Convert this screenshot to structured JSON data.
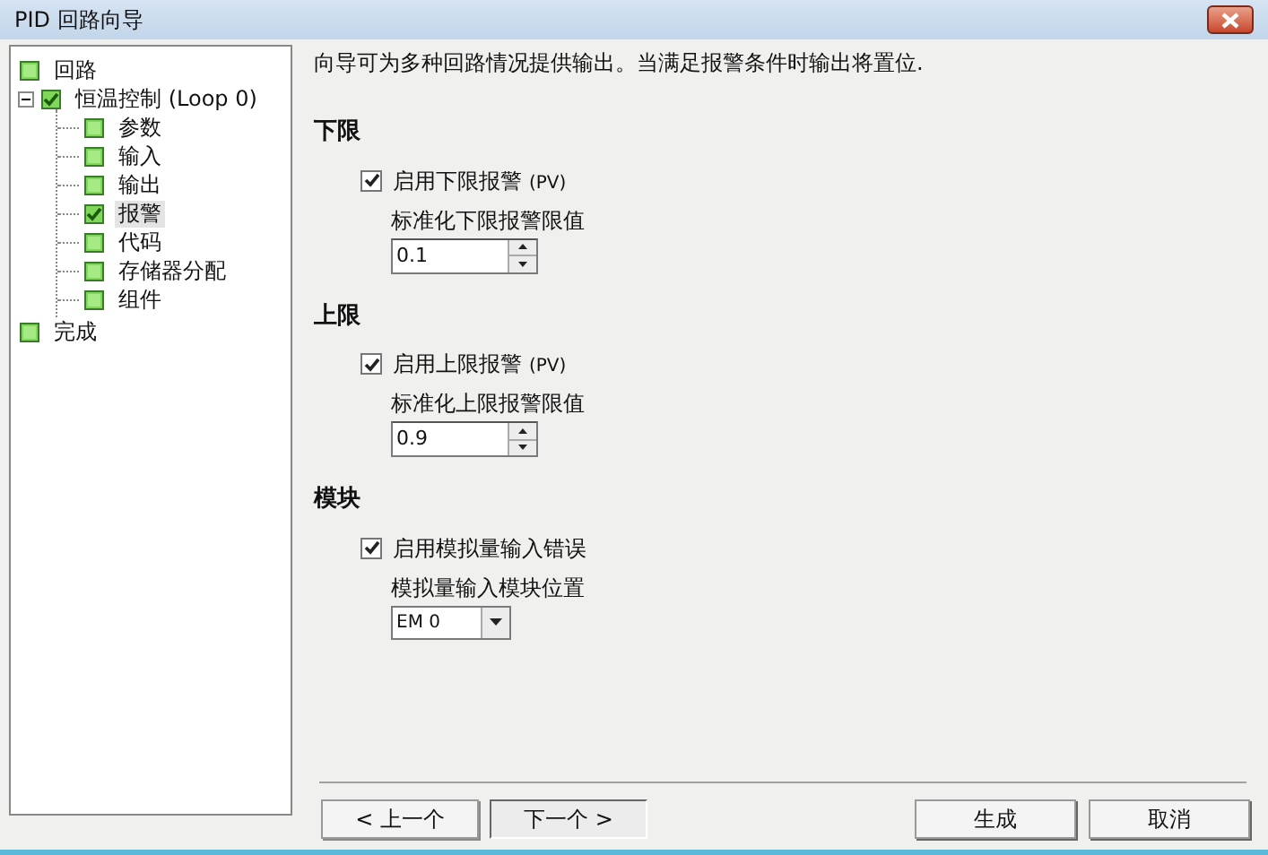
{
  "window": {
    "title": "PID 回路向导"
  },
  "tree": [
    {
      "label": "回路",
      "checked": false,
      "selected": false
    },
    {
      "label": "恒温控制 (Loop 0)",
      "checked": true,
      "selected": false,
      "expanded": true,
      "children": [
        {
          "label": "参数",
          "checked": false,
          "selected": false
        },
        {
          "label": "输入",
          "checked": false,
          "selected": false
        },
        {
          "label": "输出",
          "checked": false,
          "selected": false
        },
        {
          "label": "报警",
          "checked": true,
          "selected": true
        },
        {
          "label": "代码",
          "checked": false,
          "selected": false
        },
        {
          "label": "存储器分配",
          "checked": false,
          "selected": false
        },
        {
          "label": "组件",
          "checked": false,
          "selected": false
        }
      ]
    },
    {
      "label": "完成",
      "checked": false,
      "selected": false
    }
  ],
  "intro": "向导可为多种回路情况提供输出。当满足报警条件时输出将置位.",
  "sections": [
    {
      "heading": "下限",
      "checkbox": {
        "label": "启用下限报警",
        "suffix": "(PV)",
        "checked": true
      },
      "field_label": "标准化下限报警限值",
      "field": {
        "kind": "spinner",
        "value": "0.1"
      }
    },
    {
      "heading": "上限",
      "checkbox": {
        "label": "启用上限报警",
        "suffix": "(PV)",
        "checked": true
      },
      "field_label": "标准化上限报警限值",
      "field": {
        "kind": "spinner",
        "value": "0.9"
      }
    },
    {
      "heading": "模块",
      "checkbox": {
        "label": "启用模拟量输入错误",
        "checked": true
      },
      "field_label": "模拟量输入模块位置",
      "field": {
        "kind": "dropdown",
        "value": "EM 0"
      }
    }
  ],
  "buttons_left": [
    {
      "label": "< 上一个",
      "focused": false
    },
    {
      "label": "下一个 >",
      "focused": true
    }
  ],
  "buttons_right": [
    {
      "label": "生成"
    },
    {
      "label": "取消"
    }
  ]
}
